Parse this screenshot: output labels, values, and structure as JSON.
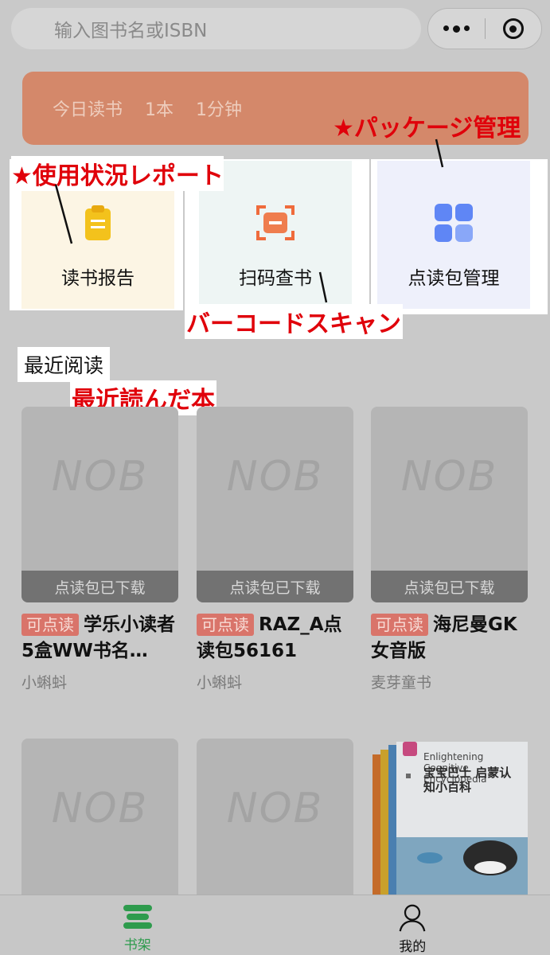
{
  "search": {
    "placeholder": "输入图书名或ISBN"
  },
  "today": {
    "label": "今日读书",
    "books": "1本",
    "minutes": "1分钟"
  },
  "features": [
    {
      "label": "读书报告"
    },
    {
      "label": "扫码查书"
    },
    {
      "label": "点读包管理"
    }
  ],
  "annotations": {
    "report": "★使用状況レポート",
    "package": "★パッケージ管理",
    "scan": "バーコードスキャン",
    "recent": "最近読んだ本"
  },
  "section": {
    "title": "最近阅读"
  },
  "books": [
    {
      "cover": "NOB",
      "status": "点读包已下载",
      "tag": "可点读",
      "title": "学乐小读者5盒WW书名…",
      "author": "小蝌蚪"
    },
    {
      "cover": "NOB",
      "status": "点读包已下载",
      "tag": "可点读",
      "title": "RAZ_A点读包56161",
      "author": "小蝌蚪"
    },
    {
      "cover": "NOB",
      "status": "点读包已下载",
      "tag": "可点读",
      "title": "海尼曼GK女音版",
      "author": "麦芽童书"
    },
    {
      "cover": "NOB"
    },
    {
      "cover": "NOB"
    },
    {
      "cover_text": "宝宝巴士 启蒙认知小百科",
      "cover_sub": "Enlightening Cognitive Encyclopedia"
    }
  ],
  "tabs": [
    {
      "label": "书架",
      "active": true,
      "color": "#2e9b4d"
    },
    {
      "label": "我的",
      "active": false
    }
  ]
}
